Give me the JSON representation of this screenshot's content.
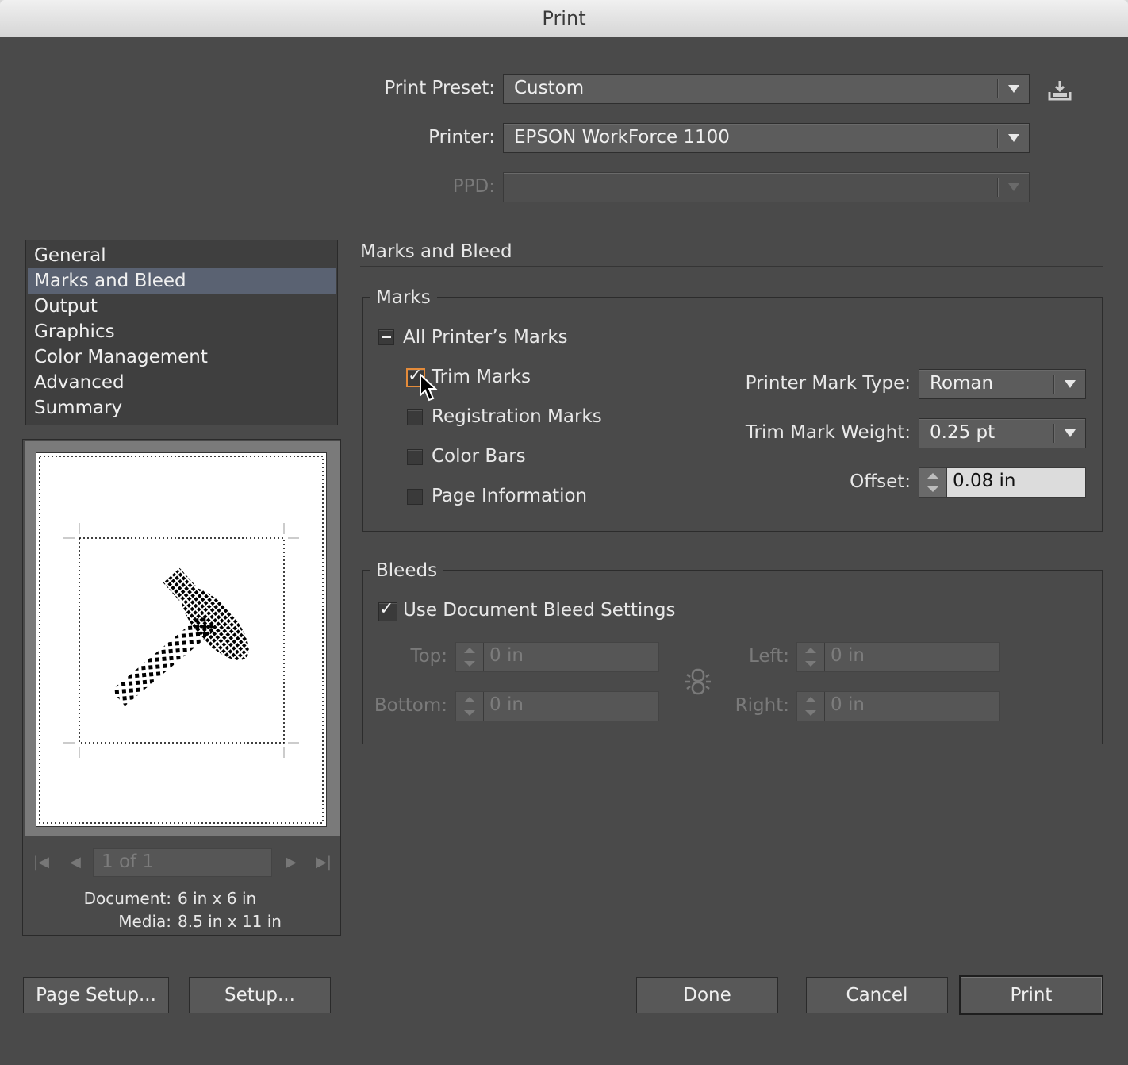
{
  "window": {
    "title": "Print"
  },
  "header": {
    "preset_label": "Print Preset:",
    "preset_value": "Custom",
    "printer_label": "Printer:",
    "printer_value": "EPSON WorkForce 1100",
    "ppd_label": "PPD:",
    "ppd_value": ""
  },
  "sidebar": {
    "items": [
      {
        "label": "General"
      },
      {
        "label": "Marks and Bleed"
      },
      {
        "label": "Output"
      },
      {
        "label": "Graphics"
      },
      {
        "label": "Color Management"
      },
      {
        "label": "Advanced"
      },
      {
        "label": "Summary"
      }
    ],
    "selected": "Marks and Bleed"
  },
  "preview": {
    "page_field": "1 of 1",
    "document_label": "Document:",
    "document_value": "6 in x 6 in",
    "media_label": "Media:",
    "media_value": "8.5 in x 11 in"
  },
  "section_title": "Marks and Bleed",
  "marks": {
    "group_title": "Marks",
    "all_marks_label": "All Printer’s Marks",
    "trim_marks_label": "Trim Marks",
    "trim_marks_checked": true,
    "registration_label": "Registration Marks",
    "registration_checked": false,
    "color_bars_label": "Color Bars",
    "color_bars_checked": false,
    "page_info_label": "Page Information",
    "page_info_checked": false,
    "mark_type_label": "Printer Mark Type:",
    "mark_type_value": "Roman",
    "weight_label": "Trim Mark Weight:",
    "weight_value": "0.25 pt",
    "offset_label": "Offset:",
    "offset_value": "0.08 in"
  },
  "bleeds": {
    "group_title": "Bleeds",
    "use_doc_label": "Use Document Bleed Settings",
    "use_doc_checked": true,
    "top_label": "Top:",
    "top_value": "0 in",
    "bottom_label": "Bottom:",
    "bottom_value": "0 in",
    "left_label": "Left:",
    "left_value": "0 in",
    "right_label": "Right:",
    "right_value": "0 in"
  },
  "buttons": {
    "page_setup": "Page Setup...",
    "setup": "Setup...",
    "done": "Done",
    "cancel": "Cancel",
    "print": "Print"
  },
  "icons": {
    "save_preset": "save-preset-icon",
    "chain": "chain-link-icon",
    "cursor": "mouse-pointer-icon"
  }
}
